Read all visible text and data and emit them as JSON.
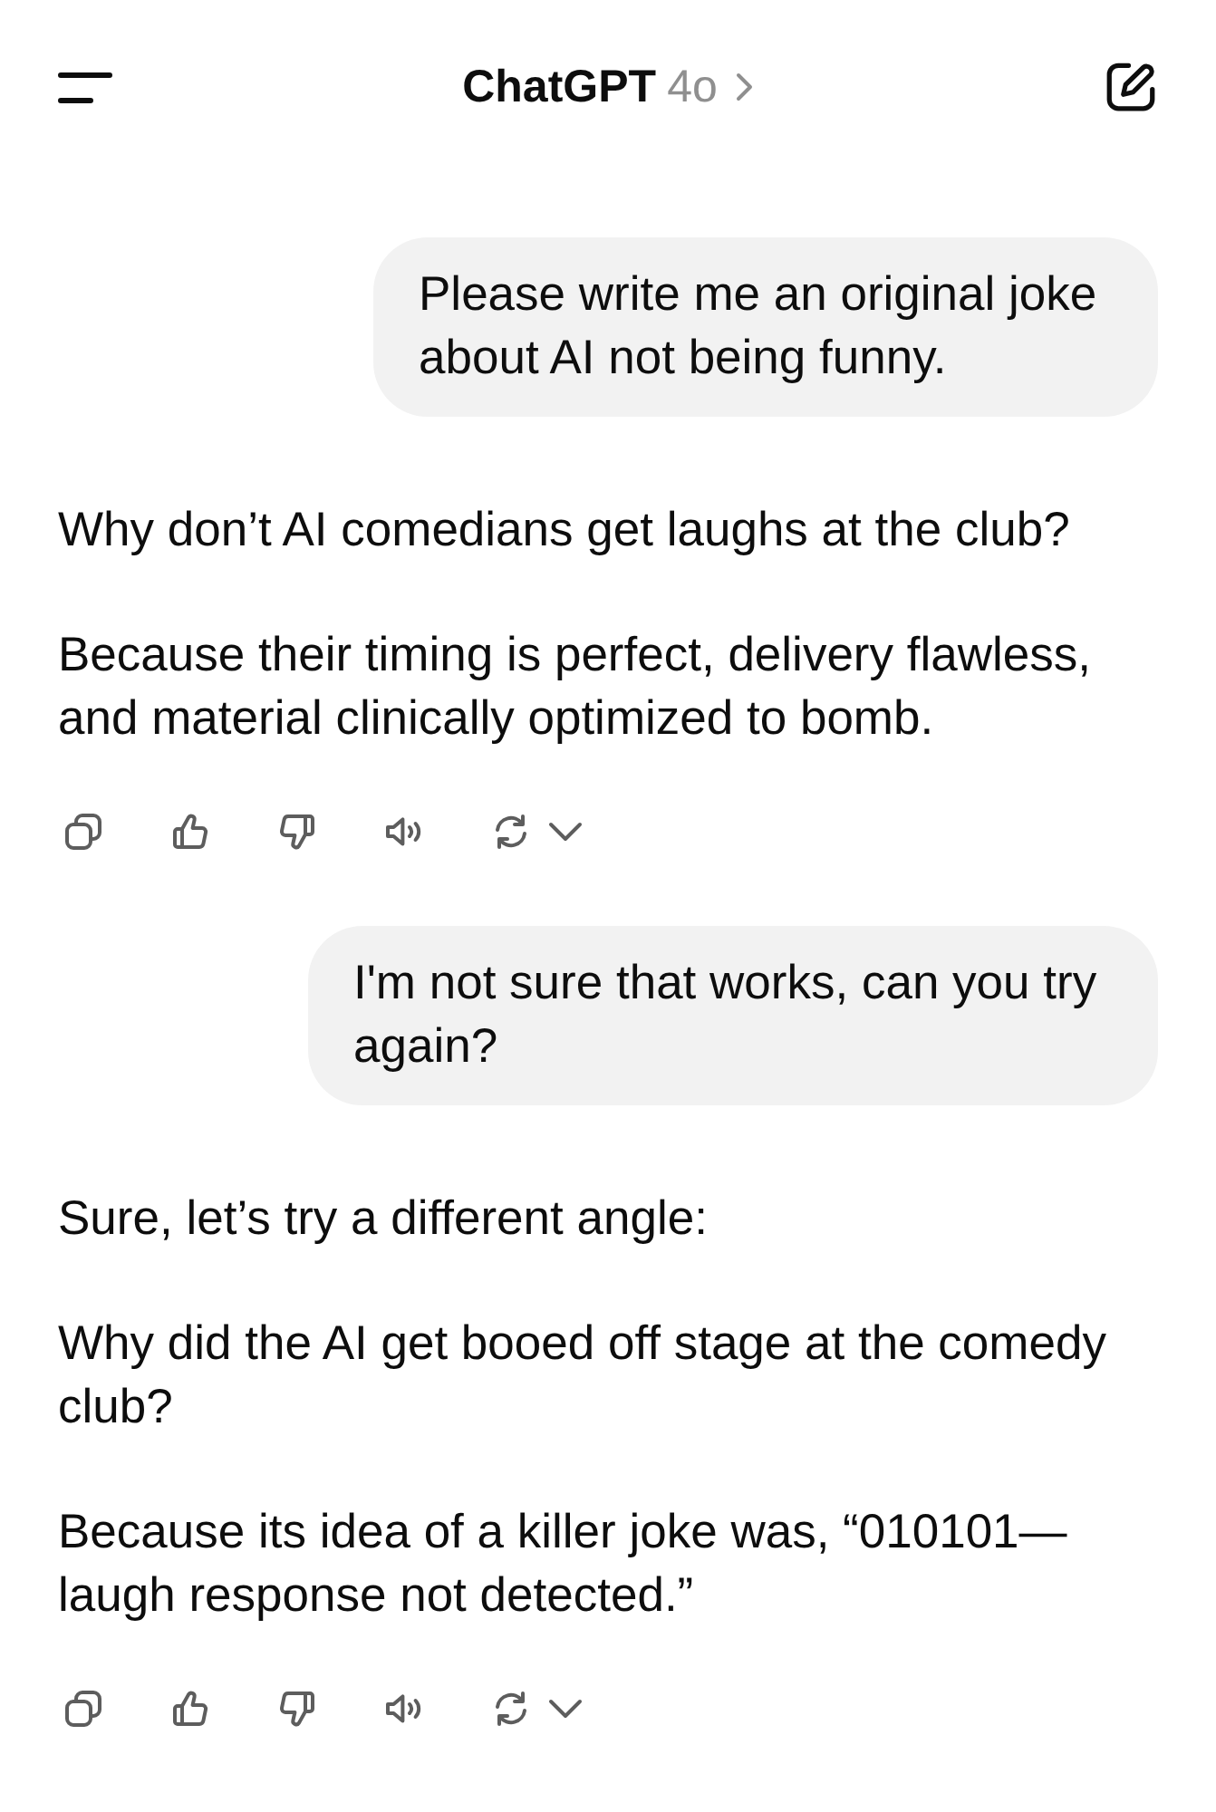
{
  "header": {
    "title": "ChatGPT",
    "model": "4o"
  },
  "messages": [
    {
      "kind": "user",
      "text": "Please write me an original joke about AI not being funny."
    },
    {
      "kind": "assistant",
      "paragraphs": [
        "Why don’t AI comedians get laughs at the club?",
        "Because their timing is perfect, delivery flawless, and material clinically optimized to bomb."
      ]
    },
    {
      "kind": "user",
      "text": "I'm not sure that works, can you try again?"
    },
    {
      "kind": "assistant",
      "paragraphs": [
        "Sure, let’s try a different angle:",
        "Why did the AI get booed off stage at the comedy club?",
        "Because its idea of a killer joke was, “010101—laugh response not detected.”"
      ]
    }
  ]
}
